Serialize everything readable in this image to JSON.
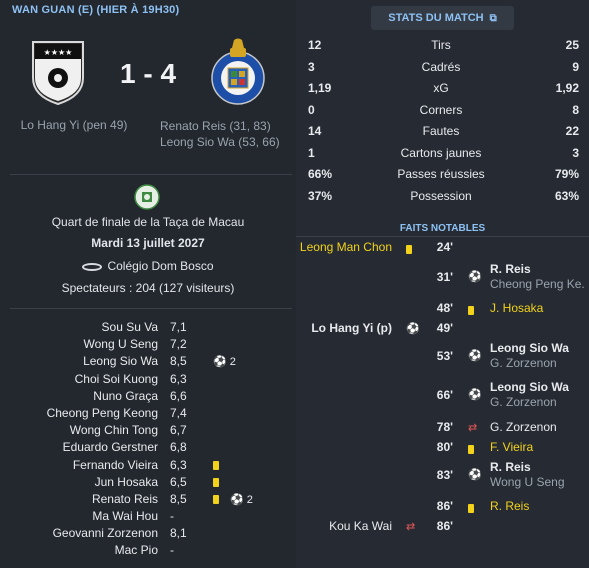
{
  "header": {
    "title": "WAN GUAN (E) (HIER À 19H30)"
  },
  "match": {
    "score": "1 - 4",
    "home_scorers": [
      "Lo Hang Yi (pen 49)"
    ],
    "away_scorers": [
      "Renato Reis (31, 83)",
      "Leong Sio Wa (53, 66)"
    ],
    "competition": "Quart de finale de la Taça de Macau",
    "date": "Mardi 13 juillet 2027",
    "stadium": "Colégio Dom Bosco",
    "attendance": "Spectateurs : 204 (127 visiteurs)"
  },
  "players": [
    {
      "name": "Sou Su Va",
      "rating": "7,1"
    },
    {
      "name": "Wong U Seng",
      "rating": "7,2"
    },
    {
      "name": "Leong Sio Wa",
      "rating": "8,5",
      "goals": "2"
    },
    {
      "name": "Choi Soi Kuong",
      "rating": "6,3"
    },
    {
      "name": "Nuno Graça",
      "rating": "6,6"
    },
    {
      "name": "Cheong Peng Keong",
      "rating": "7,4"
    },
    {
      "name": "Wong Chin Tong",
      "rating": "6,7"
    },
    {
      "name": "Eduardo Gerstner",
      "rating": "6,8"
    },
    {
      "name": "Fernando Vieira",
      "rating": "6,3",
      "yellow": true
    },
    {
      "name": "Jun Hosaka",
      "rating": "6,5",
      "yellow": true
    },
    {
      "name": "Renato Reis",
      "rating": "8,5",
      "yellow": true,
      "goals": "2"
    },
    {
      "name": "Ma Wai Hou",
      "rating": "-"
    },
    {
      "name": "Geovanni Zorzenon",
      "rating": "8,1"
    },
    {
      "name": "Mac Pio",
      "rating": "-"
    }
  ],
  "stats_button": {
    "label": "STATS DU MATCH"
  },
  "stats": [
    {
      "label": "Tirs",
      "home": "12",
      "away": "25"
    },
    {
      "label": "Cadrés",
      "home": "3",
      "away": "9"
    },
    {
      "label": "xG",
      "home": "1,19",
      "away": "1,92"
    },
    {
      "label": "Corners",
      "home": "0",
      "away": "8"
    },
    {
      "label": "Fautes",
      "home": "14",
      "away": "22"
    },
    {
      "label": "Cartons jaunes",
      "home": "1",
      "away": "3"
    },
    {
      "label": "Passes réussies",
      "home": "66%",
      "away": "79%"
    },
    {
      "label": "Possession",
      "home": "37%",
      "away": "63%"
    }
  ],
  "faits": {
    "title": "FAITS NOTABLES",
    "events": [
      {
        "minute": "24'",
        "side": "home",
        "type": "yellow",
        "name": "Leong Man Chon"
      },
      {
        "minute": "31'",
        "side": "away",
        "type": "goal",
        "name": "R. Reis",
        "sub": "Cheong Peng Ke..."
      },
      {
        "minute": "48'",
        "side": "away",
        "type": "yellow",
        "name": "J. Hosaka"
      },
      {
        "minute": "49'",
        "side": "home",
        "type": "goal",
        "name": "Lo Hang Yi (p)"
      },
      {
        "minute": "53'",
        "side": "away",
        "type": "goal",
        "name": "Leong Sio Wa",
        "sub": "G. Zorzenon"
      },
      {
        "minute": "66'",
        "side": "away",
        "type": "goal",
        "name": "Leong Sio Wa",
        "sub": "G. Zorzenon"
      },
      {
        "minute": "78'",
        "side": "away",
        "type": "sub",
        "name": "G. Zorzenon"
      },
      {
        "minute": "80'",
        "side": "away",
        "type": "yellow",
        "name": "F. Vieira"
      },
      {
        "minute": "83'",
        "side": "away",
        "type": "goal",
        "name": "R. Reis",
        "sub": "Wong U Seng"
      },
      {
        "minute": "86'",
        "side": "away",
        "type": "yellow",
        "name": "R. Reis"
      },
      {
        "minute": "86'",
        "side": "home",
        "type": "sub",
        "name": "Kou Ka Wai"
      }
    ]
  }
}
